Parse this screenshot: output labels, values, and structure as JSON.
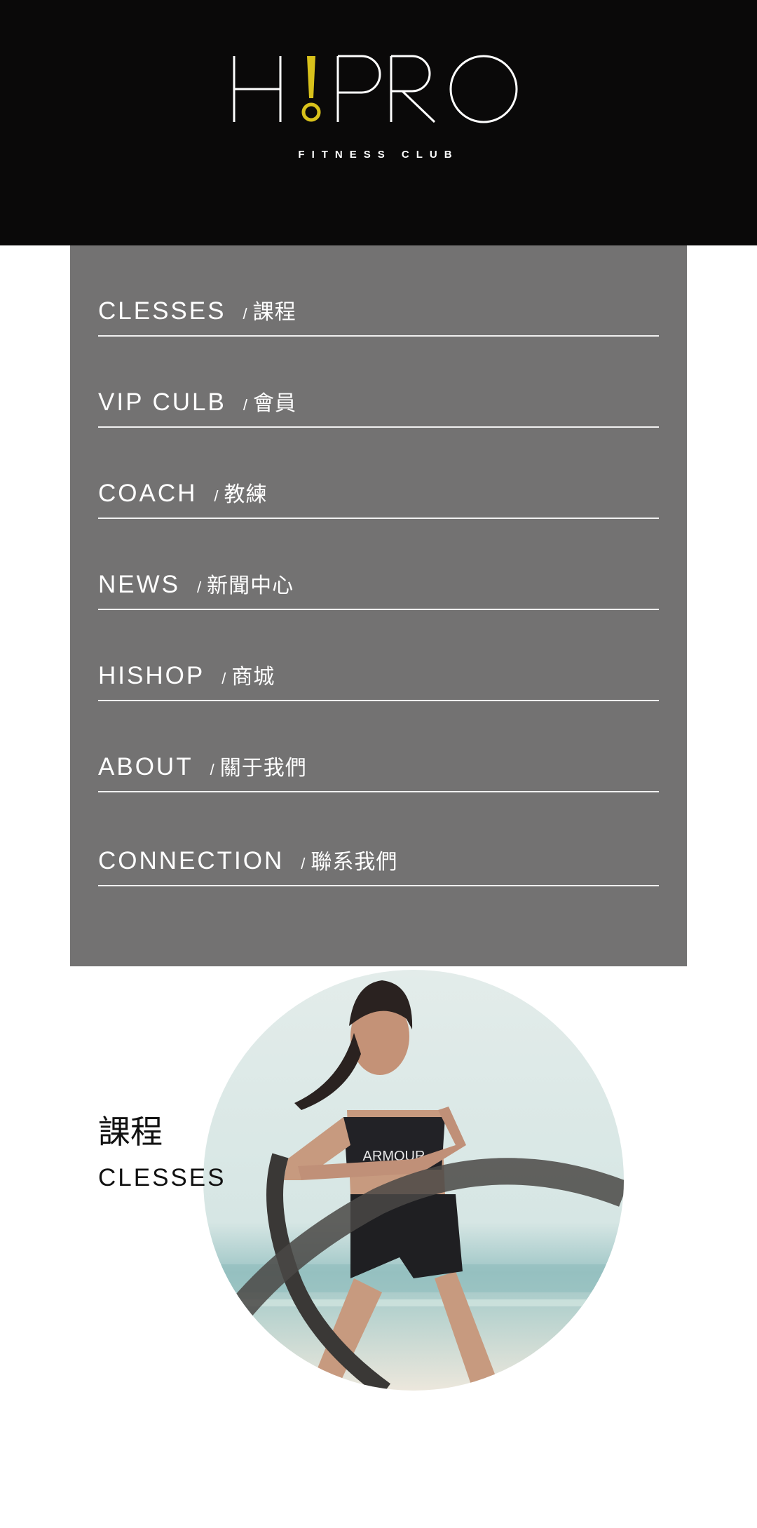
{
  "brand": {
    "logo_text": "H!PRO",
    "tagline": "FITNESS CLUB",
    "accent_color": "#d8c11b"
  },
  "menu": {
    "items": [
      {
        "en": "CLESSES",
        "sep": "/",
        "zh": "課程"
      },
      {
        "en": "VIP CULB",
        "sep": "/",
        "zh": "會員"
      },
      {
        "en": "COACH",
        "sep": "/",
        "zh": "教練"
      },
      {
        "en": "NEWS",
        "sep": "/",
        "zh": "新聞中心"
      },
      {
        "en": "HISHOP",
        "sep": "/",
        "zh": "商城"
      },
      {
        "en": "ABOUT",
        "sep": "/",
        "zh": "關于我們"
      },
      {
        "en": "CONNECTION",
        "sep": "/",
        "zh": "聯系我們"
      }
    ]
  },
  "section": {
    "title_zh": "課程",
    "title_en": "CLESSES",
    "photo_alt": "battle-rope-workout-photo",
    "photo_text": "ARMOUR"
  },
  "colors": {
    "header_bg": "#0a0909",
    "menu_bg": "#737272",
    "divider": "#f2f2f2"
  }
}
